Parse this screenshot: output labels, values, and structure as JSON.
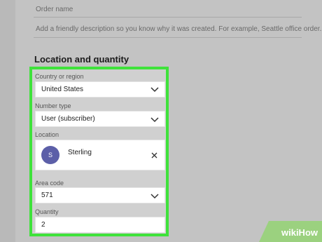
{
  "form": {
    "order_name_placeholder": "Order name",
    "description_placeholder": "Add a friendly description so you know why it was created. For example, Seattle office order.."
  },
  "location_section": {
    "title": "Location and quantity",
    "country": {
      "label": "Country or region",
      "value": "United States"
    },
    "number_type": {
      "label": "Number type",
      "value": "User (subscriber)"
    },
    "location": {
      "label": "Location",
      "avatar_initial": "S",
      "value": "Sterling"
    },
    "area_code": {
      "label": "Area code",
      "value": "571"
    },
    "quantity": {
      "label": "Quantity",
      "value": "2"
    }
  },
  "watermark": {
    "text": "wikiHow",
    "color": "#9bd17f"
  },
  "colors": {
    "highlight": "#3fe23b",
    "avatar": "#5c5fa8"
  }
}
